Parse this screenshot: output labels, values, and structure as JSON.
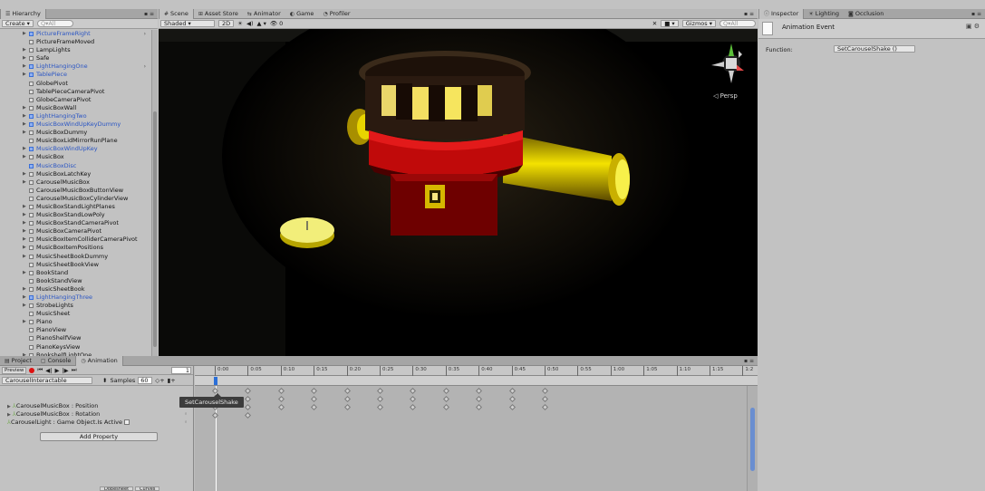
{
  "hierarchy": {
    "tab": "Hierarchy",
    "create": "Create",
    "search_placeholder": "Q▾All",
    "items": [
      {
        "label": "PictureFrameRight",
        "prefab": true,
        "expandable": true,
        "more": true
      },
      {
        "label": "PictureFrameMoved",
        "prefab": false,
        "expandable": false
      },
      {
        "label": "LampLights",
        "prefab": false,
        "expandable": true
      },
      {
        "label": "Safe",
        "prefab": false,
        "expandable": true
      },
      {
        "label": "LightHangingOne",
        "prefab": true,
        "expandable": true,
        "more": true
      },
      {
        "label": "TablePiece",
        "prefab": true,
        "expandable": true
      },
      {
        "label": "GlobePivot",
        "prefab": false,
        "expandable": false
      },
      {
        "label": "TablePieceCameraPivot",
        "prefab": false,
        "expandable": false
      },
      {
        "label": "GlobeCameraPivot",
        "prefab": false,
        "expandable": false
      },
      {
        "label": "MusicBoxWall",
        "prefab": false,
        "expandable": true
      },
      {
        "label": "LightHangingTwo",
        "prefab": true,
        "expandable": true
      },
      {
        "label": "MusicBoxWindUpKeyDummy",
        "prefab": true,
        "expandable": true
      },
      {
        "label": "MusicBoxDummy",
        "prefab": false,
        "expandable": true
      },
      {
        "label": "MusicBoxLidMirrorRunPlane",
        "prefab": false,
        "expandable": false
      },
      {
        "label": "MusicBoxWindUpKey",
        "prefab": true,
        "expandable": true
      },
      {
        "label": "MusicBox",
        "prefab": false,
        "expandable": true
      },
      {
        "label": "MusicBoxDisc",
        "prefab": true,
        "expandable": false
      },
      {
        "label": "MusicBoxLatchKey",
        "prefab": false,
        "expandable": true
      },
      {
        "label": "CarouselMusicBox",
        "prefab": false,
        "expandable": true
      },
      {
        "label": "CarouselMusicBoxButtonView",
        "prefab": false,
        "expandable": false
      },
      {
        "label": "CarouselMusicBoxCylinderView",
        "prefab": false,
        "expandable": false
      },
      {
        "label": "MusicBoxStandLightPlanes",
        "prefab": false,
        "expandable": true
      },
      {
        "label": "MusicBoxStandLowPoly",
        "prefab": false,
        "expandable": true
      },
      {
        "label": "MusicBoxStandCameraPivot",
        "prefab": false,
        "expandable": true
      },
      {
        "label": "MusicBoxCameraPivot",
        "prefab": false,
        "expandable": true
      },
      {
        "label": "MusicBoxItemColliderCameraPivot",
        "prefab": false,
        "expandable": true
      },
      {
        "label": "MusicBoxItemPositions",
        "prefab": false,
        "expandable": true
      },
      {
        "label": "MusicSheetBookDummy",
        "prefab": false,
        "expandable": true
      },
      {
        "label": "MusicSheetBookView",
        "prefab": false,
        "expandable": false
      },
      {
        "label": "BookStand",
        "prefab": false,
        "expandable": true
      },
      {
        "label": "BookStandView",
        "prefab": false,
        "expandable": false
      },
      {
        "label": "MusicSheetBook",
        "prefab": false,
        "expandable": true
      },
      {
        "label": "LightHangingThree",
        "prefab": true,
        "expandable": true
      },
      {
        "label": "StrobeLights",
        "prefab": false,
        "expandable": true
      },
      {
        "label": "MusicSheet",
        "prefab": false,
        "expandable": false
      },
      {
        "label": "Piano",
        "prefab": false,
        "expandable": true
      },
      {
        "label": "PianoView",
        "prefab": false,
        "expandable": false
      },
      {
        "label": "PianoShelfView",
        "prefab": false,
        "expandable": false
      },
      {
        "label": "PianoKeysView",
        "prefab": false,
        "expandable": false
      },
      {
        "label": "BookshelfLightOne",
        "prefab": false,
        "expandable": true
      }
    ]
  },
  "scene": {
    "tabs": [
      {
        "icon": "#",
        "label": "Scene"
      },
      {
        "icon": "⊞",
        "label": "Asset Store"
      },
      {
        "icon": "⇆",
        "label": "Animator"
      },
      {
        "icon": "◐",
        "label": "Game"
      },
      {
        "icon": "◔",
        "label": "Profiler"
      }
    ],
    "shading": "Shaded",
    "mode_2d": "2D",
    "gizmos": "Gizmos",
    "search_placeholder": "Q▾All",
    "persp_label": "◁ Persp",
    "toolbar_icons": [
      "light-toggle-icon",
      "audio-toggle-icon",
      "effects-icon"
    ],
    "layers_count": "0"
  },
  "inspector": {
    "tabs": [
      {
        "icon": "ⓘ",
        "label": "Inspector"
      },
      {
        "icon": "☀",
        "label": "Lighting"
      },
      {
        "icon": "◙",
        "label": "Occlusion"
      }
    ],
    "title": "Animation Event",
    "function_label": "Function:",
    "function_value": "SetCarouselShake ()"
  },
  "bottom_tabs": [
    {
      "icon": "▤",
      "label": "Project"
    },
    {
      "icon": "▢",
      "label": "Console"
    },
    {
      "icon": "◷",
      "label": "Animation"
    }
  ],
  "animation": {
    "preview": "Preview",
    "frame": "1",
    "clip": "CarouselInteractable",
    "samples_label": "Samples",
    "samples_value": "60",
    "properties": [
      {
        "label": "CarouselMusicBox : Position",
        "expandable": true
      },
      {
        "label": "CarouselMusicBox : Rotation",
        "expandable": true
      },
      {
        "label": "CarouselLight : Game Object.Is Active",
        "expandable": false,
        "checkbox": true
      }
    ],
    "add_property": "Add Property",
    "bottom_tabs": [
      "Dopesheet",
      "Curves"
    ],
    "ruler_labels": [
      "0:00",
      "0:05",
      "0:10",
      "0:15",
      "0:20",
      "0:25",
      "0:30",
      "0:35",
      "0:40",
      "0:45",
      "0:50",
      "0:55",
      "1:00",
      "1:05",
      "1:10",
      "1:15",
      "1:2"
    ],
    "tooltip": "SetCarouselShake"
  }
}
